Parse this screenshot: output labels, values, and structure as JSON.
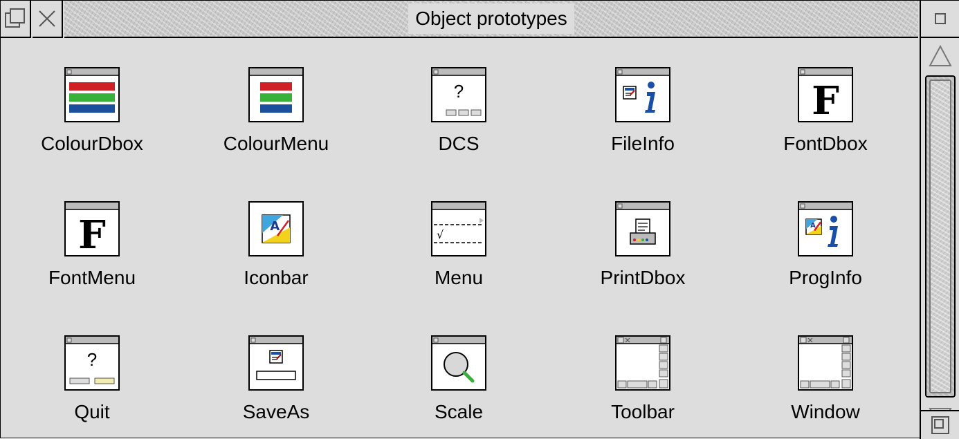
{
  "window": {
    "title": "Object prototypes"
  },
  "icons": {
    "back": "back-icon",
    "close": "close-icon",
    "toggle": "toggle-size-icon",
    "up": "scroll-up-arrow-icon",
    "down": "scroll-down-arrow-icon",
    "resize": "resize-icon"
  },
  "prototypes": [
    {
      "label": "ColourDbox",
      "icon": "colour-dbox-icon"
    },
    {
      "label": "ColourMenu",
      "icon": "colour-menu-icon"
    },
    {
      "label": "DCS",
      "icon": "dcs-icon"
    },
    {
      "label": "FileInfo",
      "icon": "file-info-icon"
    },
    {
      "label": "FontDbox",
      "icon": "font-dbox-icon"
    },
    {
      "label": "FontMenu",
      "icon": "font-menu-icon"
    },
    {
      "label": "Iconbar",
      "icon": "iconbar-icon"
    },
    {
      "label": "Menu",
      "icon": "menu-icon"
    },
    {
      "label": "PrintDbox",
      "icon": "print-dbox-icon"
    },
    {
      "label": "ProgInfo",
      "icon": "prog-info-icon"
    },
    {
      "label": "Quit",
      "icon": "quit-icon"
    },
    {
      "label": "SaveAs",
      "icon": "save-as-icon"
    },
    {
      "label": "Scale",
      "icon": "scale-icon"
    },
    {
      "label": "Toolbar",
      "icon": "toolbar-icon"
    },
    {
      "label": "Window",
      "icon": "window-icon"
    }
  ],
  "colors": {
    "window_bg": "#dddddd",
    "red": "#d11f26",
    "green": "#37b13a",
    "blue": "#1b4e9b",
    "info_blue": "#1a4fa8"
  }
}
